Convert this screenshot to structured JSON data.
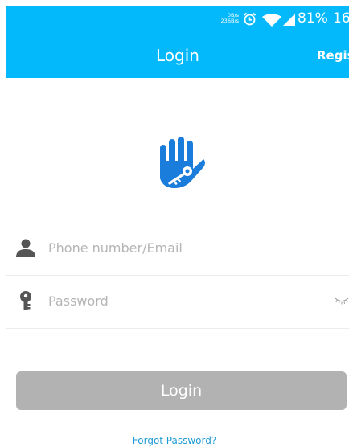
{
  "status_bar": {
    "speed_down": "0B/s",
    "speed_up": "236B/s",
    "battery": "81%",
    "clock": "16",
    "icons": [
      "alarm-icon",
      "wifi-icon",
      "signal-icon"
    ]
  },
  "header": {
    "title": "Login",
    "register_label": "Register"
  },
  "form": {
    "username": {
      "placeholder": "Phone number/Email",
      "value": "",
      "icon": "user-icon"
    },
    "password": {
      "placeholder": "Password",
      "value": "",
      "icon": "key-icon",
      "toggle_icon": "eye-closed-icon"
    },
    "login_label": "Login",
    "forgot_label": "Forgot Password?"
  },
  "logo_icon": "hand-key-icon",
  "colors": {
    "header_bg": "#03b9fb",
    "logo_blue": "#1a7ddb",
    "button_disabled": "#b2b2b2",
    "link": "#1e9ad6"
  }
}
